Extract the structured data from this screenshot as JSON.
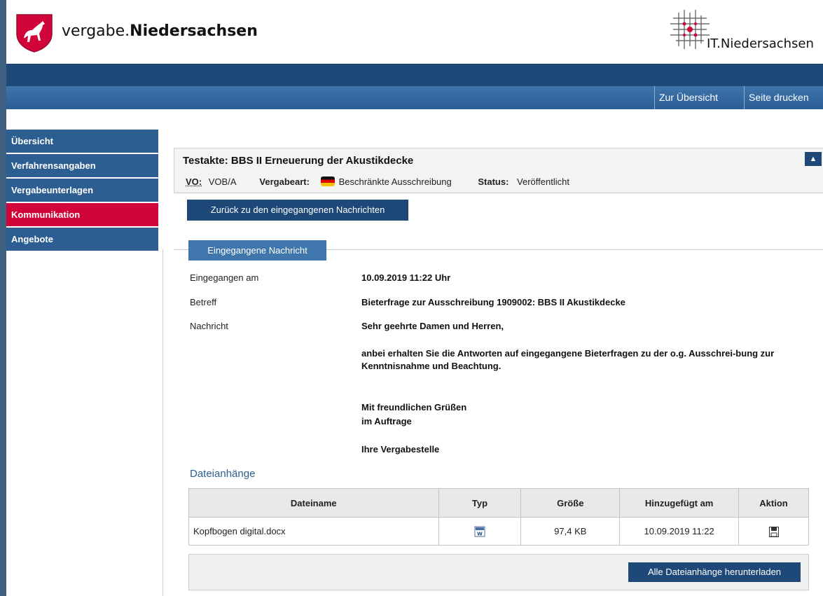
{
  "header": {
    "brand_prefix": "vergabe.",
    "brand_bold": "Niedersachsen",
    "partner": "IT.Niedersachsen",
    "colors": {
      "nav_dark": "#1d4878",
      "nav_mid": "#2c5e94",
      "active": "#d2053b"
    }
  },
  "toplinks": {
    "overview": "Zur Übersicht",
    "print": "Seite drucken"
  },
  "sidebar": {
    "items": [
      {
        "label": "Übersicht"
      },
      {
        "label": "Verfahrensangaben"
      },
      {
        "label": "Vergabeunterlagen"
      },
      {
        "label": "Kommunikation"
      },
      {
        "label": "Angebote"
      }
    ]
  },
  "akte": {
    "title": "Testakte: BBS II Erneuerung der Akustikdecke",
    "vo_label": "VO:",
    "vo_value": "VOB/A",
    "art_label": "Vergabeart:",
    "art_value": "Beschränkte Ausschreibung",
    "status_label": "Status:",
    "status_value": "Veröffentlicht",
    "collapse_icon": "caret-up-icon"
  },
  "back_button": "Zurück zu den eingegangenen Nachrichten",
  "message": {
    "tab": "Eingegangene Nachricht",
    "received_label": "Eingegangen am",
    "received_value": "10.09.2019 11:22 Uhr",
    "subject_label": "Betreff",
    "subject_value": "Bieterfrage zur Ausschreibung 1909002: BBS II Akustikdecke",
    "body_label": "Nachricht",
    "body": {
      "greeting": "Sehr geehrte Damen und Herren,",
      "text": "anbei erhalten Sie die Antworten auf eingegangene Bieterfragen zu der o.g. Ausschrei-bung zur Kenntnisnahme und Beachtung.",
      "closing1": "Mit freundlichen Grüßen",
      "closing2": "im Auftrage",
      "sender": "Ihre Vergabestelle"
    }
  },
  "attachments": {
    "title": "Dateianhänge",
    "columns": [
      "Dateiname",
      "Typ",
      "Größe",
      "Hinzugefügt am",
      "Aktion"
    ],
    "rows": [
      {
        "name": "Kopfbogen digital.docx",
        "type_icon": "word-document-icon",
        "size": "97,4 KB",
        "added": "10.09.2019 11:22",
        "action_icon": "save-icon"
      }
    ],
    "download_all": "Alle Dateianhänge herunterladen"
  }
}
